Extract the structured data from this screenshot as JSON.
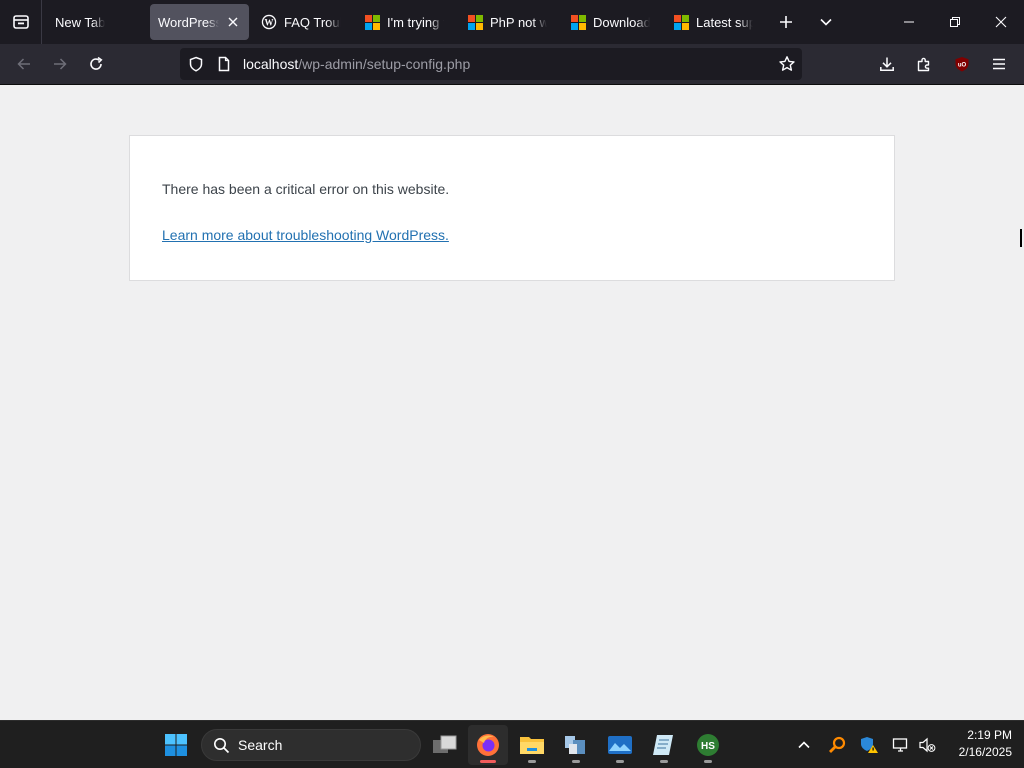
{
  "browser": {
    "tabs": [
      {
        "title": "New Tab",
        "icon": "none"
      },
      {
        "title": "WordPress › Error",
        "icon": "none",
        "active": true
      },
      {
        "title": "FAQ Troubleshooting",
        "icon": "wordpress-icon"
      },
      {
        "title": "I'm trying to",
        "icon": "microsoft-icon"
      },
      {
        "title": "PhP not working",
        "icon": "microsoft-icon"
      },
      {
        "title": "Download",
        "icon": "microsoft-icon"
      },
      {
        "title": "Latest supported",
        "icon": "microsoft-icon"
      }
    ],
    "url": {
      "host": "localhost",
      "path": "/wp-admin/setup-config.php"
    }
  },
  "page": {
    "error_message": "There has been a critical error on this website.",
    "help_link": "Learn more about troubleshooting WordPress."
  },
  "taskbar": {
    "search_placeholder": "Search",
    "time": "2:19 PM",
    "date": "2/16/2025"
  },
  "colors": {
    "tab_strip": "#1c1b22",
    "toolbar": "#2b2a33",
    "page_background": "#f0f0f1",
    "link": "#2271b1",
    "taskbar": "#1f1f1f"
  }
}
